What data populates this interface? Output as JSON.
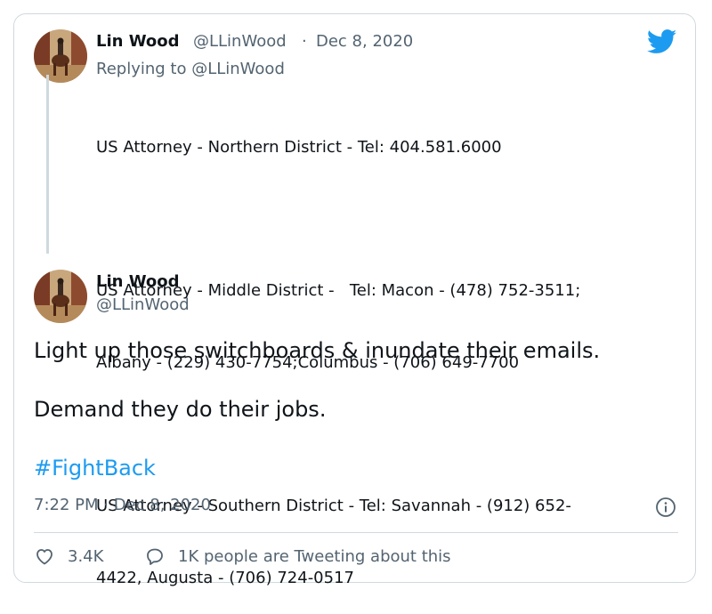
{
  "parent_tweet": {
    "display_name": "Lin Wood",
    "handle": "@LLinWood",
    "separator": "·",
    "date": "Dec 8, 2020",
    "replying_prefix": "Replying to ",
    "replying_to": "@LLinWood",
    "lines": [
      "US Attorney - Northern District - Tel: 404.581.6000",
      "US Attorney - Middle District -   Tel: Macon - (478) 752-3511;",
      "Albany - (229) 430-7754;Columbus - (706) 649-7700",
      "US Attorney - Southern District - Tel: Savannah - (912) 652-",
      "4422, Augusta - (706) 724-0517"
    ]
  },
  "main_tweet": {
    "display_name": "Lin Wood",
    "handle": "@LLinWood",
    "text_line_1": "Light up those switchboards & inundate their emails.",
    "text_line_2": "Demand they do their jobs.",
    "hashtag": "#FightBack",
    "timestamp": "7:22 PM · Dec 8, 2020"
  },
  "metrics": {
    "likes": "3.4K",
    "conversation_label": "1K people are Tweeting about this"
  },
  "icons": {
    "brand": "twitter-bird-icon",
    "info": "info-icon",
    "like": "heart-icon",
    "reply": "speech-bubble-icon"
  },
  "colors": {
    "brand_blue": "#1d9bf0",
    "secondary_text": "#536471",
    "border": "#cfd9de"
  }
}
